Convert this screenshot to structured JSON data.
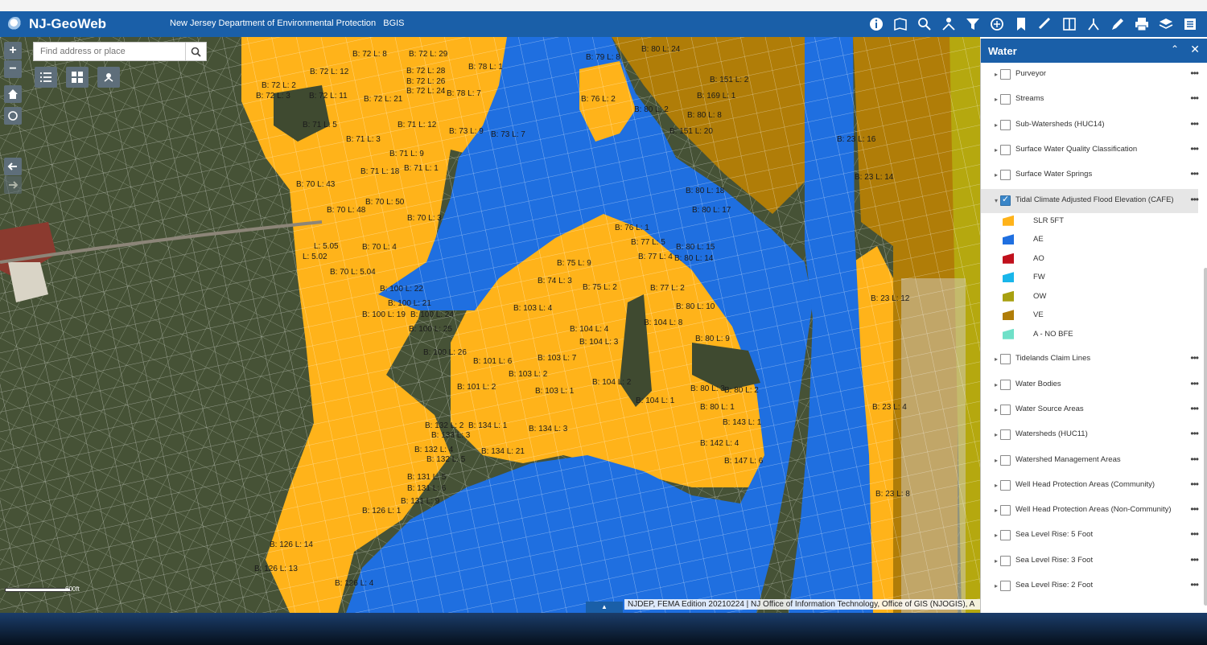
{
  "app": {
    "title": "NJ-GeoWeb",
    "agency": "New Jersey Department of Environmental Protection",
    "agency_short": "BGIS"
  },
  "toolbar": [
    "about-icon",
    "basemap-gallery-icon",
    "query-icon",
    "share-icon",
    "filter-icon",
    "analysis-icon",
    "bookmark-icon",
    "measure-icon",
    "swipe-icon",
    "select-icon",
    "draw-icon",
    "print-icon",
    "layers-icon",
    "legend-icon"
  ],
  "search": {
    "placeholder": "Find address or place"
  },
  "map": {
    "scale_label": "600ft",
    "attribution": "NJDEP, FEMA Edition 20210224 | NJ Office of Information Technology, Office of GIS (NJOGIS), A",
    "labels": [
      "B: 72 L: 8",
      "B: 72 L: 29",
      "B: 78 L: 1",
      "B: 79 L: 8",
      "B: 80 L: 24",
      "B: 72 L: 12",
      "B: 72 L: 28",
      "B: 72 L: 26",
      "B: 72 L: 24",
      "B: 78 L: 7",
      "B: 72 L: 2",
      "B: 72 L: 11",
      "B: 72 L: 3",
      "B: 72 L: 21",
      "B: 76 L: 2",
      "B: 151 L: 2",
      "B: 169 L: 1",
      "B: 80 L: 2",
      "B: 151 L: 20",
      "B: 71 L: 5",
      "B: 71 L: 12",
      "B: 73 L: 9",
      "B: 73 L: 7",
      "B: 71 L: 3",
      "B: 71 L: 9",
      "B: 71 L: 18",
      "B: 71 L: 1",
      "B: 70 L: 43",
      "B: 70 L: 50",
      "B: 70 L: 48",
      "B: 70 L: 3",
      "B: 70 L: 4",
      "B: 70 L: 5.04",
      "L: 5.05",
      "L: 5.02",
      "B: 80 L: 18",
      "B: 80 L: 17",
      "B: 76 L: 1",
      "B: 77 L: 5",
      "B: 80 L: 15",
      "B: 80 L: 14",
      "B: 77 L: 4",
      "B: 75 L: 9",
      "B: 74 L: 3",
      "B: 75 L: 2",
      "B: 77 L: 2",
      "B: 80 L: 10",
      "B: 100 L: 22",
      "B: 100 L: 21",
      "B: 100 L: 19",
      "B: 100 L: 24",
      "B: 100 L: 25",
      "B: 103 L: 4",
      "B: 104 L: 4",
      "B: 104 L: 3",
      "B: 104 L: 8",
      "B: 80 L: 9",
      "B: 100 L: 26",
      "B: 101 L: 6",
      "B: 103 L: 7",
      "B: 103 L: 2",
      "B: 104 L: 2",
      "B: 80 L: 3",
      "B: 80 L: 2",
      "B: 101 L: 2",
      "B: 103 L: 1",
      "B: 104 L: 1",
      "B: 80 L: 1",
      "B: 143 L: 1",
      "B: 132 L: 2",
      "B: 134 L: 1",
      "B: 134 L: 3",
      "B: 133 L: 3",
      "B: 142 L: 4",
      "B: 132 L: 4",
      "B: 132 L: 5",
      "B: 134 L: 21",
      "B: 147 L: 6",
      "B: 131 L: 5",
      "B: 131 L: 6",
      "B: 131 L: 9",
      "B: 126 L: 1",
      "B: 126 L: 14",
      "B: 126 L: 13",
      "B: 126 L: 4",
      "B: 23 L: 14",
      "B: 23 L: 12",
      "B: 23 L: 4",
      "B: 23 L: 8",
      "B: 80 L: 8",
      "B: 23 L: 16"
    ]
  },
  "panel": {
    "title": "Water",
    "layers": [
      {
        "name": "Purveyor",
        "checked": false
      },
      {
        "name": "Streams",
        "checked": false
      },
      {
        "name": "Sub-Watersheds (HUC14)",
        "checked": false
      },
      {
        "name": "Surface Water Quality Classification",
        "checked": false
      },
      {
        "name": "Surface Water Springs",
        "checked": false
      },
      {
        "name": "Tidal Climate Adjusted Flood Elevation (CAFE)",
        "checked": true,
        "expanded": true
      },
      {
        "name": "Tidelands Claim Lines",
        "checked": false
      },
      {
        "name": "Water Bodies",
        "checked": false
      },
      {
        "name": "Water Source Areas",
        "checked": false
      },
      {
        "name": "Watersheds (HUC11)",
        "checked": false
      },
      {
        "name": "Watershed Management Areas",
        "checked": false
      },
      {
        "name": "Well Head Protection Areas (Community)",
        "checked": false
      },
      {
        "name": "Well Head Protection Areas (Non-Community)",
        "checked": false
      },
      {
        "name": "Sea Level Rise: 5 Foot",
        "checked": false
      },
      {
        "name": "Sea Level Rise: 3 Foot",
        "checked": false
      },
      {
        "name": "Sea Level Rise: 2 Foot",
        "checked": false
      }
    ],
    "legend": [
      {
        "label": "SLR 5FT",
        "color": "#ffb31a"
      },
      {
        "label": "AE",
        "color": "#1f6fe0"
      },
      {
        "label": "AO",
        "color": "#c0101c"
      },
      {
        "label": "FW",
        "color": "#19b6ea"
      },
      {
        "label": "OW",
        "color": "#a8a010"
      },
      {
        "label": "VE",
        "color": "#b07d08"
      },
      {
        "label": "A - NO BFE",
        "color": "#6fe0c8"
      }
    ]
  }
}
